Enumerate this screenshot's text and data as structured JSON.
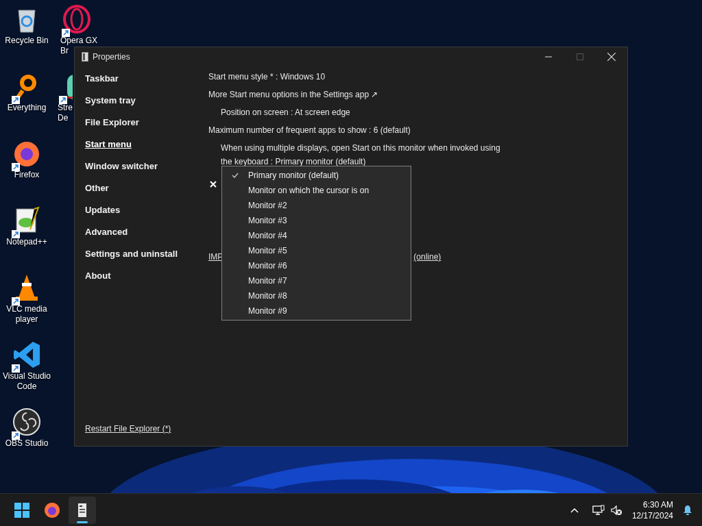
{
  "desktop_icons": [
    {
      "kind": "recycle-bin",
      "lines": [
        "Recycle Bin"
      ],
      "shortcut": false
    },
    {
      "kind": "opera",
      "lines": [
        "Opera GX",
        "Br"
      ],
      "shortcut": true
    },
    {
      "kind": "search-app",
      "lines": [
        "Everything"
      ],
      "shortcut": true
    },
    {
      "kind": "stream-deck",
      "lines": [
        "Stre",
        "De"
      ],
      "shortcut": true
    },
    {
      "kind": "firefox",
      "lines": [
        "Firefox"
      ],
      "shortcut": true
    },
    {
      "kind": "notepad",
      "lines": [
        "Notepad++"
      ],
      "shortcut": true
    },
    {
      "kind": "vlc",
      "lines": [
        "VLC media",
        "player"
      ],
      "shortcut": true
    },
    {
      "kind": "vscode",
      "lines": [
        "Visual Studio",
        "Code"
      ],
      "shortcut": true
    },
    {
      "kind": "obs",
      "lines": [
        "OBS Studio"
      ],
      "shortcut": true
    }
  ],
  "window": {
    "title": "Properties"
  },
  "sidebar": {
    "items": [
      {
        "label": "Taskbar",
        "selected": false
      },
      {
        "label": "System tray",
        "selected": false
      },
      {
        "label": "File Explorer",
        "selected": false
      },
      {
        "label": "Start menu",
        "selected": true
      },
      {
        "label": "Window switcher",
        "selected": false
      },
      {
        "label": "Other",
        "selected": false
      },
      {
        "label": "Updates",
        "selected": false
      },
      {
        "label": "Advanced",
        "selected": false
      },
      {
        "label": "Settings and uninstall",
        "selected": false
      },
      {
        "label": "About",
        "selected": false
      }
    ],
    "footer_link": "Restart File Explorer (*)"
  },
  "settings": [
    {
      "kind": "option",
      "text": "Start menu style * : Windows 10"
    },
    {
      "kind": "option",
      "text": "More Start menu options in the Settings app ↗"
    },
    {
      "kind": "sub-option",
      "text": "Position on screen : At screen edge"
    },
    {
      "kind": "option",
      "text": "Maximum number of frequent apps to show : 6 (default)"
    },
    {
      "kind": "sub-option",
      "text": "When using multiple displays, open Start on this monitor when invoked using the keyboard : Primary monitor (default)"
    }
  ],
  "hidden_link": {
    "left": "IMP",
    "right": "(online)"
  },
  "dropdown": {
    "items": [
      {
        "label": "Primary monitor (default)",
        "selected": true
      },
      {
        "label": "Monitor on which the cursor is on",
        "selected": false
      },
      {
        "label": "Monitor #2",
        "selected": false
      },
      {
        "label": "Monitor #3",
        "selected": false
      },
      {
        "label": "Monitor #4",
        "selected": false
      },
      {
        "label": "Monitor #5",
        "selected": false
      },
      {
        "label": "Monitor #6",
        "selected": false
      },
      {
        "label": "Monitor #7",
        "selected": false
      },
      {
        "label": "Monitor #8",
        "selected": false
      },
      {
        "label": "Monitor #9",
        "selected": false
      }
    ]
  },
  "taskbar": {
    "apps": [
      {
        "kind": "start",
        "active": false
      },
      {
        "kind": "firefox",
        "active": false
      },
      {
        "kind": "properties",
        "active": true
      }
    ],
    "time": "6:30 AM",
    "date": "12/17/2024"
  }
}
